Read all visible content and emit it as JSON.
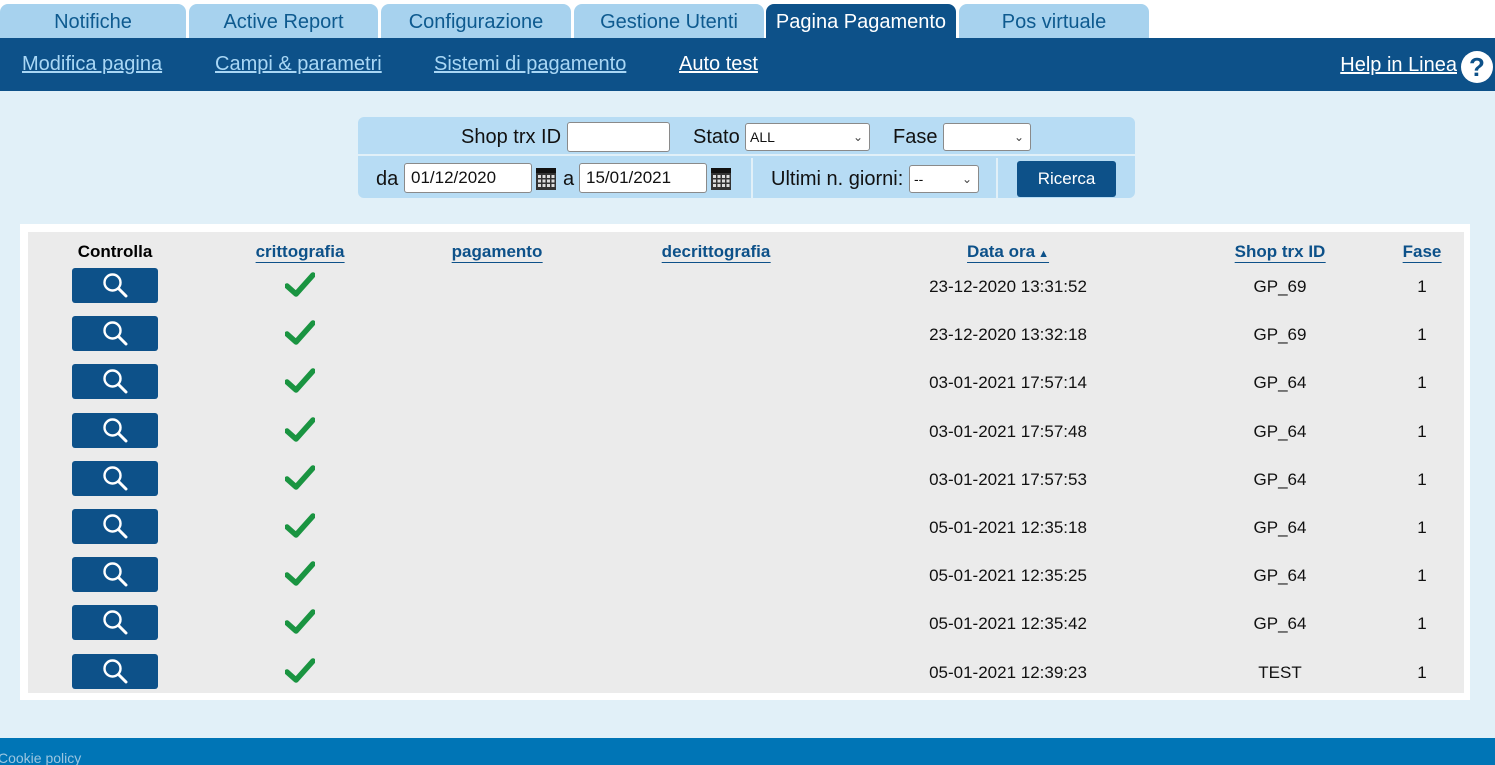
{
  "tabs": [
    {
      "label": "Notifiche",
      "active": false
    },
    {
      "label": "Active Report",
      "active": false
    },
    {
      "label": "Configurazione",
      "active": false
    },
    {
      "label": "Gestione Utenti",
      "active": false
    },
    {
      "label": "Pagina Pagamento",
      "active": true
    },
    {
      "label": "Pos virtuale",
      "active": false
    }
  ],
  "subnav": {
    "items": [
      "Modifica pagina",
      "Campi & parametri",
      "Sistemi di pagamento",
      "Auto test"
    ],
    "current": "Auto test",
    "help_label": "Help in Linea",
    "help_icon": "?"
  },
  "filter": {
    "shop_trx_label": "Shop trx ID",
    "shop_trx_value": "",
    "stato_label": "Stato",
    "stato_value": "ALL",
    "fase_label": "Fase",
    "fase_value": "",
    "da_label": "da",
    "da_value": "01/12/2020",
    "a_label": "a",
    "a_value": "15/01/2021",
    "ultimi_label": "Ultimi n. giorni:",
    "ultimi_value": "--",
    "search_button": "Ricerca"
  },
  "table": {
    "headers": {
      "controlla": "Controlla",
      "crittografia": "crittografia",
      "pagamento": "pagamento",
      "decrittografia": "decrittografia",
      "data_ora": "Data ora",
      "data_ora_sort_icon": "▲",
      "shop_trx_id": "Shop trx ID",
      "fase": "Fase"
    },
    "rows": [
      {
        "data_ora": "23-12-2020 13:31:52",
        "shop_trx_id": "GP_69",
        "fase": "1",
        "crittografia_ok": true
      },
      {
        "data_ora": "23-12-2020 13:32:18",
        "shop_trx_id": "GP_69",
        "fase": "1",
        "crittografia_ok": true
      },
      {
        "data_ora": "03-01-2021 17:57:14",
        "shop_trx_id": "GP_64",
        "fase": "1",
        "crittografia_ok": true
      },
      {
        "data_ora": "03-01-2021 17:57:48",
        "shop_trx_id": "GP_64",
        "fase": "1",
        "crittografia_ok": true
      },
      {
        "data_ora": "03-01-2021 17:57:53",
        "shop_trx_id": "GP_64",
        "fase": "1",
        "crittografia_ok": true
      },
      {
        "data_ora": "05-01-2021 12:35:18",
        "shop_trx_id": "GP_64",
        "fase": "1",
        "crittografia_ok": true
      },
      {
        "data_ora": "05-01-2021 12:35:25",
        "shop_trx_id": "GP_64",
        "fase": "1",
        "crittografia_ok": true
      },
      {
        "data_ora": "05-01-2021 12:35:42",
        "shop_trx_id": "GP_64",
        "fase": "1",
        "crittografia_ok": true
      },
      {
        "data_ora": "05-01-2021 12:39:23",
        "shop_trx_id": "TEST",
        "fase": "1",
        "crittografia_ok": true
      }
    ]
  },
  "footer": {
    "cookie_label": "Cookie policy"
  },
  "colors": {
    "brand_dark": "#0d5189",
    "tab_inactive": "#a7d2ee",
    "panel_bg": "#e1f0f8",
    "filter_bg": "#b7dcf4",
    "check_green": "#1a9441",
    "footer": "#0075b6"
  },
  "icons": {
    "view_button": "magnifier-icon",
    "crittografia_ok": "checkmark-icon",
    "calendar": "calendar-icon",
    "help": "help-circle-icon",
    "select": "chevron-down-icon"
  }
}
